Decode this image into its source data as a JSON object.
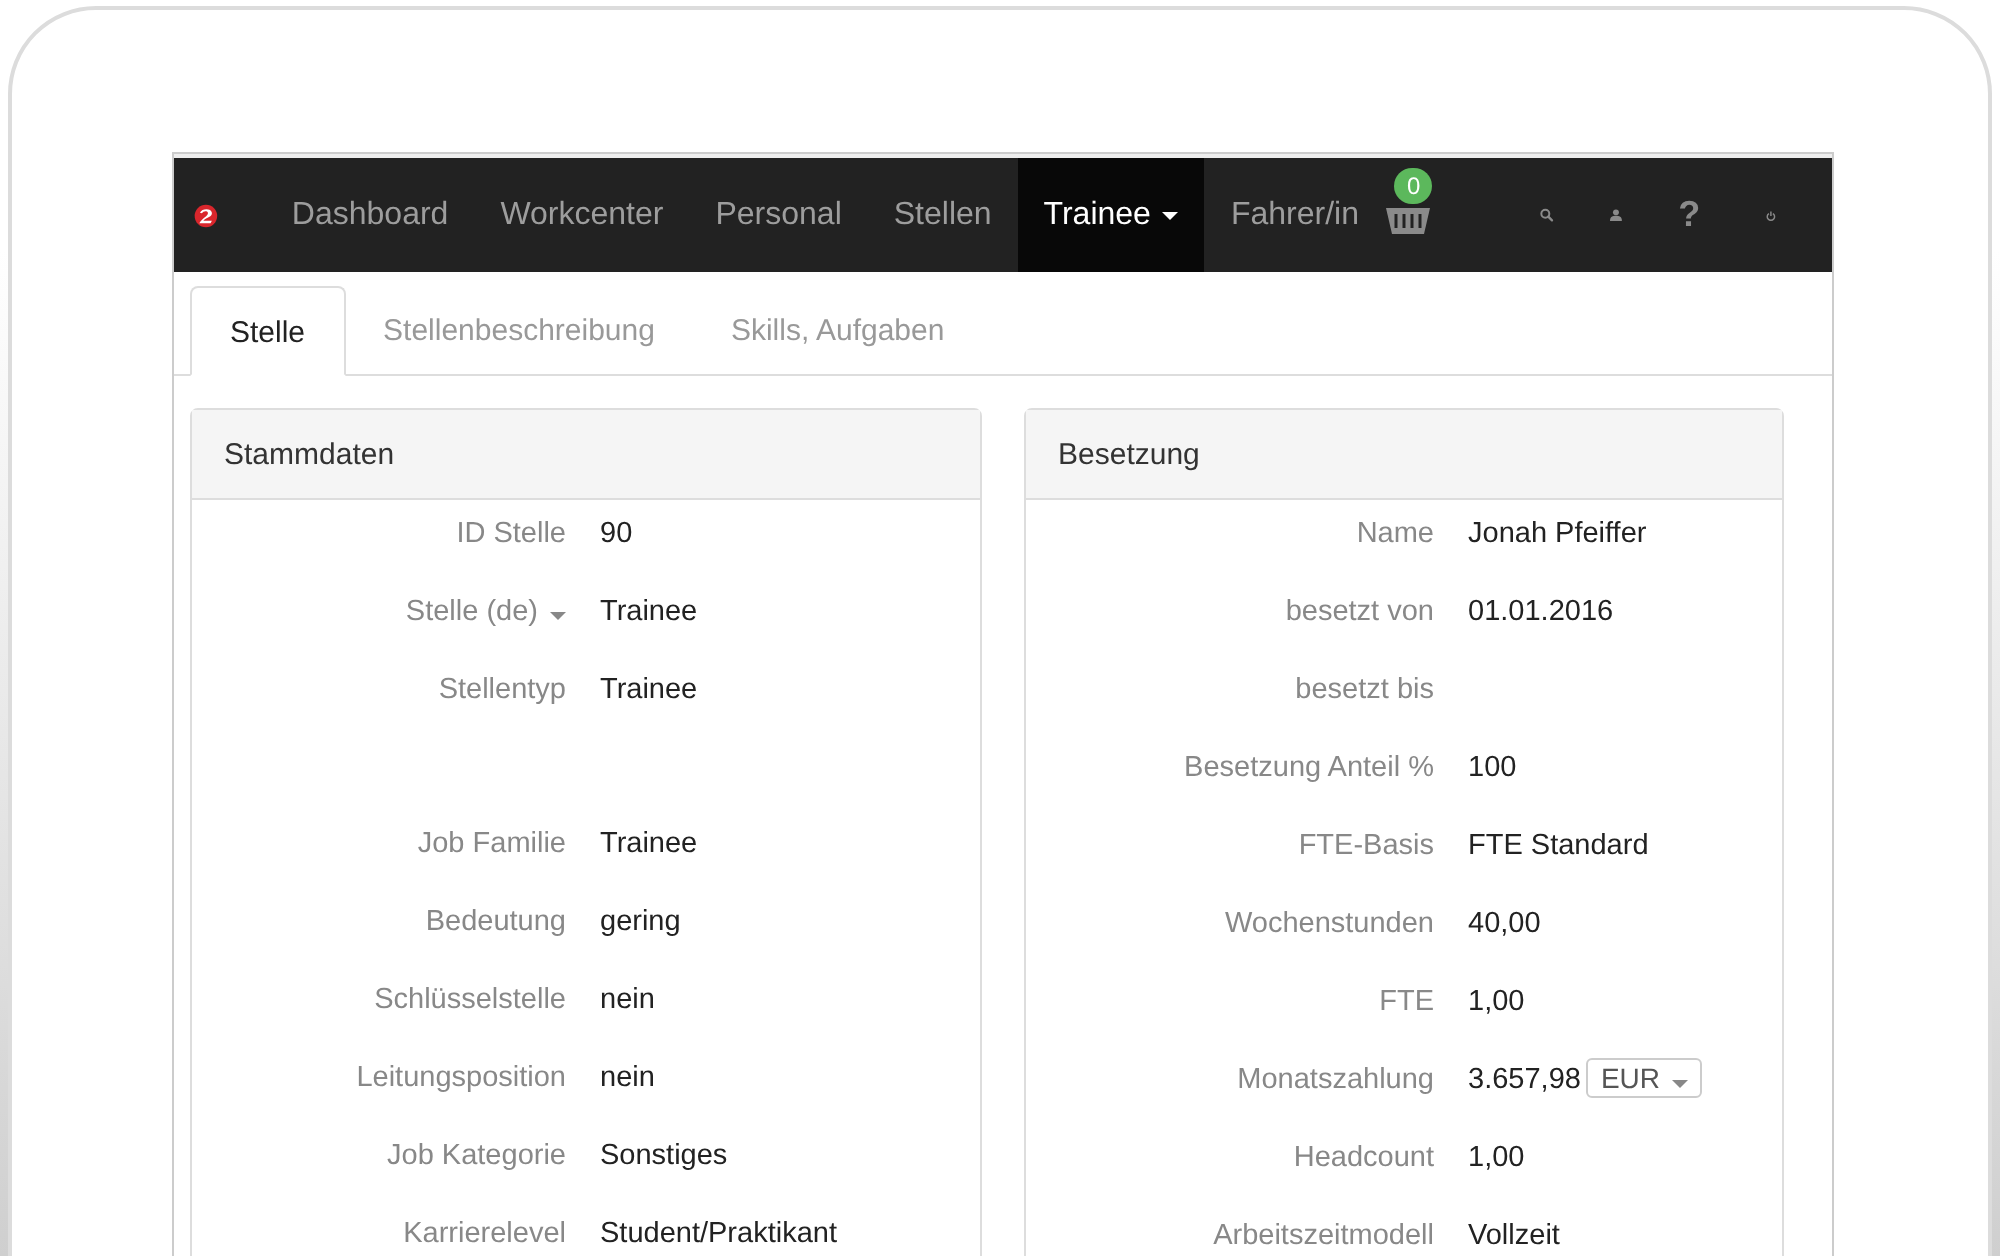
{
  "navbar": {
    "items": [
      {
        "label": "Dashboard",
        "selected": false,
        "dropdown": false
      },
      {
        "label": "Workcenter",
        "selected": false,
        "dropdown": false
      },
      {
        "label": "Personal",
        "selected": false,
        "dropdown": false
      },
      {
        "label": "Stellen",
        "selected": false,
        "dropdown": false
      },
      {
        "label": "Trainee",
        "selected": true,
        "dropdown": true
      },
      {
        "label": "Fahrer/in",
        "selected": false,
        "dropdown": false
      }
    ],
    "basket_count": "0",
    "help_glyph": "?"
  },
  "tabs": [
    {
      "label": "Stelle",
      "selected": true
    },
    {
      "label": "Stellenbeschreibung",
      "selected": false
    },
    {
      "label": "Skills, Aufgaben",
      "selected": false
    }
  ],
  "panels": [
    {
      "title": "Stammdaten",
      "rows": [
        {
          "label": "ID Stelle",
          "value": "90"
        },
        {
          "label": "Stelle (de)",
          "value": "Trainee",
          "dropdown": true
        },
        {
          "label": "Stellentyp",
          "value": "Trainee",
          "gap_after": true
        },
        {
          "label": "Job Familie",
          "value": "Trainee"
        },
        {
          "label": "Bedeutung",
          "value": "gering"
        },
        {
          "label": "Schlüsselstelle",
          "value": "nein"
        },
        {
          "label": "Leitungsposition",
          "value": "nein"
        },
        {
          "label": "Job Kategorie",
          "value": "Sonstiges"
        },
        {
          "label": "Karrierelevel",
          "value": "Student/Praktikant"
        }
      ]
    },
    {
      "title": "Besetzung",
      "rows": [
        {
          "label": "Name",
          "value": "Jonah Pfeiffer"
        },
        {
          "label": "besetzt von",
          "value": "01.01.2016"
        },
        {
          "label": "besetzt bis"
        },
        {
          "label": "Besetzung Anteil %",
          "value": "100"
        },
        {
          "label": "FTE-Basis",
          "value": "FTE Standard"
        },
        {
          "label": "Wochenstunden",
          "value": "40,00"
        },
        {
          "label": "FTE",
          "value": "1,00"
        },
        {
          "label": "Monatszahlung",
          "value": "3.657,98",
          "currency": "EUR"
        },
        {
          "label": "Headcount",
          "value": "1,00"
        },
        {
          "label": "Arbeitszeitmodell",
          "value": "Vollzeit"
        }
      ]
    }
  ]
}
